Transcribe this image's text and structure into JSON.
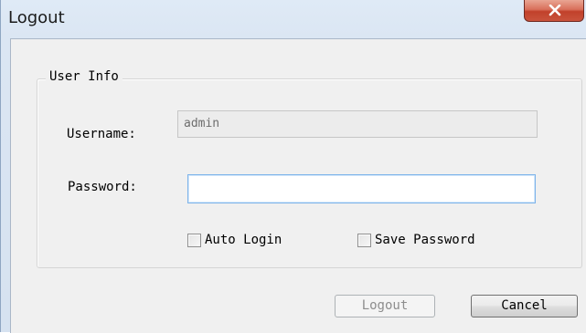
{
  "window": {
    "title": "Logout",
    "close_icon": "close-x-icon"
  },
  "group": {
    "title": "User Info"
  },
  "form": {
    "username_label": "Username:",
    "username_value": "admin",
    "password_label": "Password:",
    "password_value": ""
  },
  "options": {
    "auto_login_label": "Auto Login",
    "auto_login_checked": false,
    "save_password_label": "Save Password",
    "save_password_checked": false
  },
  "buttons": {
    "logout_label": "Logout",
    "logout_enabled": false,
    "cancel_label": "Cancel"
  },
  "colors": {
    "close_button": "#c9533c",
    "dialog_background": "#f0f0f0",
    "focus_border": "#7eb4ea"
  }
}
